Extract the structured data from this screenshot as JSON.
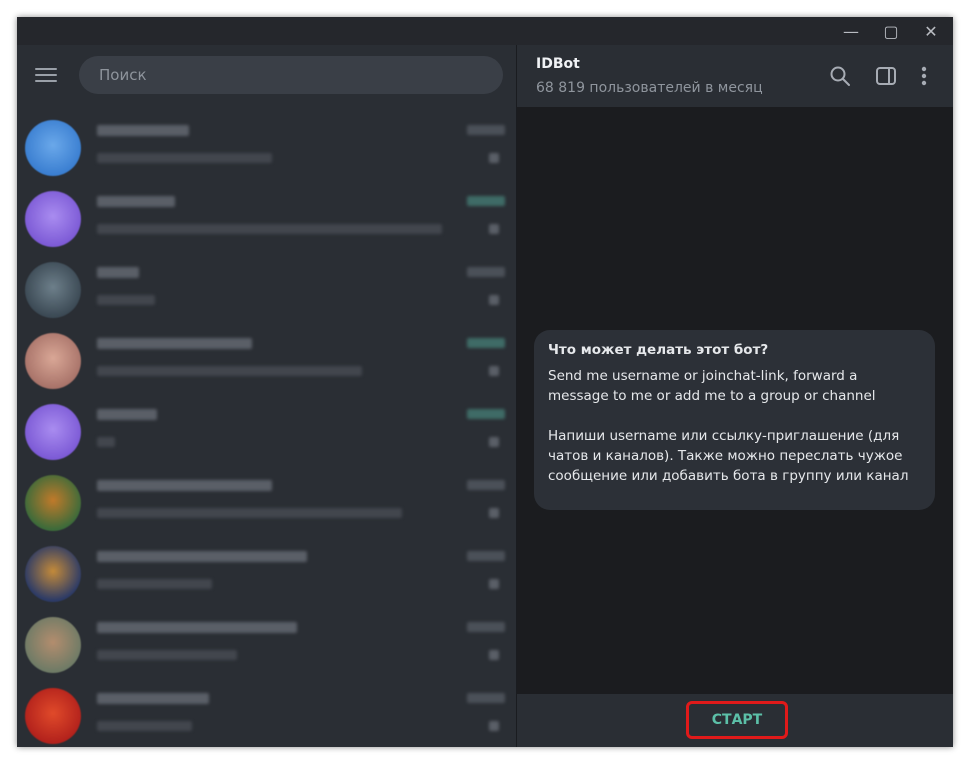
{
  "window_controls": {
    "minimize": "—",
    "maximize": "▢",
    "close": "✕"
  },
  "sidebar": {
    "search_placeholder": "Поиск"
  },
  "chat": {
    "title": "IDBot",
    "subtitle": "68 819 пользователей в месяц",
    "header_icons": [
      "search-icon",
      "sidebar-toggle-icon",
      "more-vertical-icon"
    ],
    "info_bubble": {
      "heading": "Что может делать этот бот?",
      "paragraph1_line1": "Send me username or joinchat-link, forward a",
      "paragraph1_line2": "message to me or add me to a group or channel",
      "paragraph2_line1": "Напиши username или ссылку-приглашение (для",
      "paragraph2_line2": "чатов и каналов). Также можно переслать чужое",
      "paragraph2_line3": "сообщение или добавить бота в группу или канал"
    },
    "start_button": "СТАРТ"
  },
  "colors": {
    "accent": "#5cc0a8",
    "highlight_border": "#e01a1a",
    "panel": "#2a2e34",
    "chat_bg": "#1b1c1f"
  }
}
